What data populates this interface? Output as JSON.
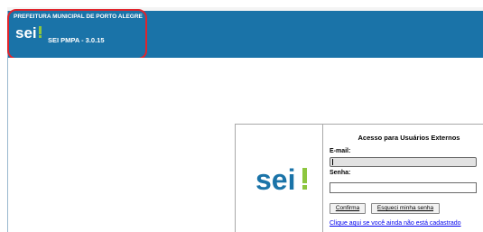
{
  "header": {
    "org_title": "PREFEITURA MUNICIPAL DE PORTO ALEGRE",
    "logo_text": "sei!",
    "system_name": "SEI PMPA - 3.0.15"
  },
  "login": {
    "logo_text": "sei!",
    "title": "Acesso para Usuários Externos",
    "email_label": "E-mail:",
    "email_value": "",
    "password_label": "Senha:",
    "password_value": "",
    "confirm_button": "Confirma",
    "forgot_button": "Esqueci minha senha",
    "register_link": "Clique aqui se você ainda não está cadastrado"
  },
  "colors": {
    "header_blue": "#1a73a8",
    "highlight_red": "#e0242c",
    "logo_green": "#8dc63f",
    "logo_blue": "#1a73a8"
  }
}
